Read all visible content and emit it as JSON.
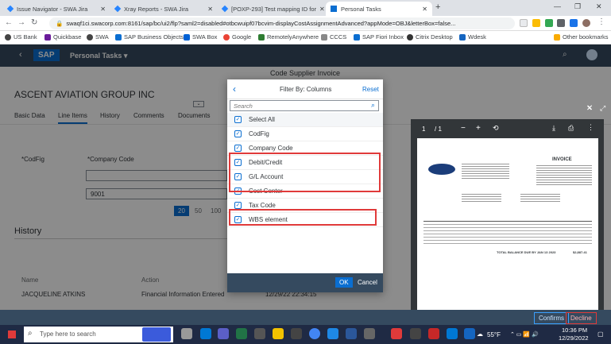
{
  "browser": {
    "tabs": [
      {
        "title": "Issue Navigator - SWA Jira",
        "icon": "jira-icon",
        "active": false
      },
      {
        "title": "Xray Reports - SWA Jira",
        "icon": "jira-icon",
        "active": false
      },
      {
        "title": "[POXP-293] Test mapping ID for",
        "icon": "jira-icon",
        "active": false
      },
      {
        "title": "Personal Tasks",
        "icon": "sap-icon",
        "active": true
      }
    ],
    "url": "swaqf1ci.swacorp.com:8161/sap/bc/ui2/flp?saml2=disabled#otbcwuipf07bcvim-displayCostAssignmentAdvanced?appMode=OBJ&letterBox=false...",
    "bookmarks": [
      "US Bank",
      "Quickbase",
      "SWA",
      "SAP Business Objects",
      "SWA Box",
      "Google",
      "RemotelyAnywhere",
      "CCCS",
      "SAP Fiori Inbox",
      "Citrix Desktop",
      "Wdesk"
    ],
    "other_bookmarks": "Other bookmarks"
  },
  "sap": {
    "logo": "SAP",
    "app_title": "Personal Tasks ▾",
    "page_header": "Code Supplier Invoice",
    "company": "ASCENT AVIATION GROUP INC",
    "tabs": [
      "Basic Data",
      "Line Items",
      "History",
      "Comments",
      "Documents"
    ],
    "active_tab": "Line Items",
    "col_codfig": "*CodFig",
    "col_company": "*Company Code",
    "company_value": "9001",
    "page_sizes": [
      "20",
      "50",
      "100"
    ],
    "history_title": "History",
    "history_cols": [
      "Name",
      "Action"
    ],
    "history_row": {
      "name": "JACQUELINE ATKINS",
      "action": "Financial Information Entered",
      "date": "12/29/22 22:34:15"
    },
    "footer_buttons": [
      "Confirms",
      "Decline"
    ]
  },
  "dialog": {
    "title": "Filter By: Columns",
    "reset": "Reset",
    "search_placeholder": "Search",
    "items": [
      {
        "label": "Select All",
        "checked": true
      },
      {
        "label": "CodFig",
        "checked": true
      },
      {
        "label": "Company Code",
        "checked": true
      },
      {
        "label": "Debit/Credit",
        "checked": true
      },
      {
        "label": "G/L Account",
        "checked": true
      },
      {
        "label": "Cost Center",
        "checked": true
      },
      {
        "label": "Tax Code",
        "checked": true
      },
      {
        "label": "WBS element",
        "checked": true
      }
    ],
    "ok": "OK",
    "cancel": "Cancel"
  },
  "pdf": {
    "page": "1",
    "of": "/ 1",
    "doc_title": "INVOICE",
    "total_label": "TOTAL BALANCE DUE BY JAN 13 2023",
    "total_value": "$2,887.41"
  },
  "taskbar": {
    "search_placeholder": "Type here to search",
    "weather": "55°F",
    "time": "10:36 PM",
    "date": "12/29/2022"
  }
}
